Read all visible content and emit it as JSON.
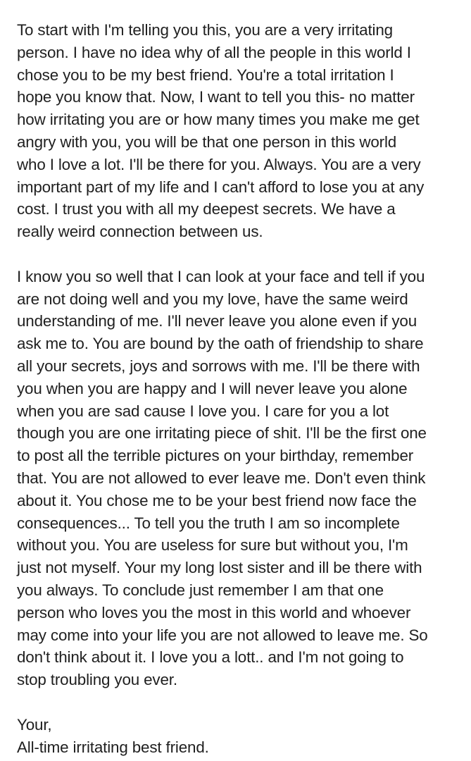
{
  "post": {
    "paragraph1_lines": [
      "To start with I'm telling you this, you are a very irritating",
      "person. I have no idea why of all the people in this world I",
      "chose you to be my best friend. You're a total irritation I",
      "hope you know that. Now, I want to tell you this- no matter",
      "how irritating you are or how many times you make me get",
      "angry with you, you will be that one person in this world",
      "who I love a lot. I'll be there for you. Always. You are a very",
      "important part of my life and I can't afford to lose you at any",
      "cost. I trust you with all my deepest secrets. We have a",
      "really weird connection between us."
    ],
    "paragraph2_lines": [
      "I know you so well that I can look at your face and tell if you",
      "are not doing well and you my love, have the same weird",
      "understanding of me. I'll never leave you alone even if you",
      "ask me to. You are bound by the oath of friendship to share",
      "all your secrets, joys and sorrows with me. I'll be there with",
      "you when you are happy and I will never leave you alone",
      "when you are sad cause I love you. I care for you a lot",
      "though you are one irritating piece of shit. I'll be the first one",
      "to post all the terrible pictures on your birthday, remember",
      "that. You are not allowed to ever leave me. Don't even think",
      "about it. You chose me to be your best friend now face the",
      "consequences... To tell you the truth I am so incomplete",
      "without you. You are useless for sure but without you, I'm",
      "just not myself. Your my long lost sister and ill be there with",
      "you always. To conclude just remember I am that one",
      "person who loves you the most in this world and whoever",
      "may come into your life you are not allowed to leave me. So",
      "don't think about it. I love you a lott.. and I'm not going to",
      "stop troubling you ever."
    ],
    "closing": "Your,",
    "signature": "All-time irritating best friend."
  }
}
